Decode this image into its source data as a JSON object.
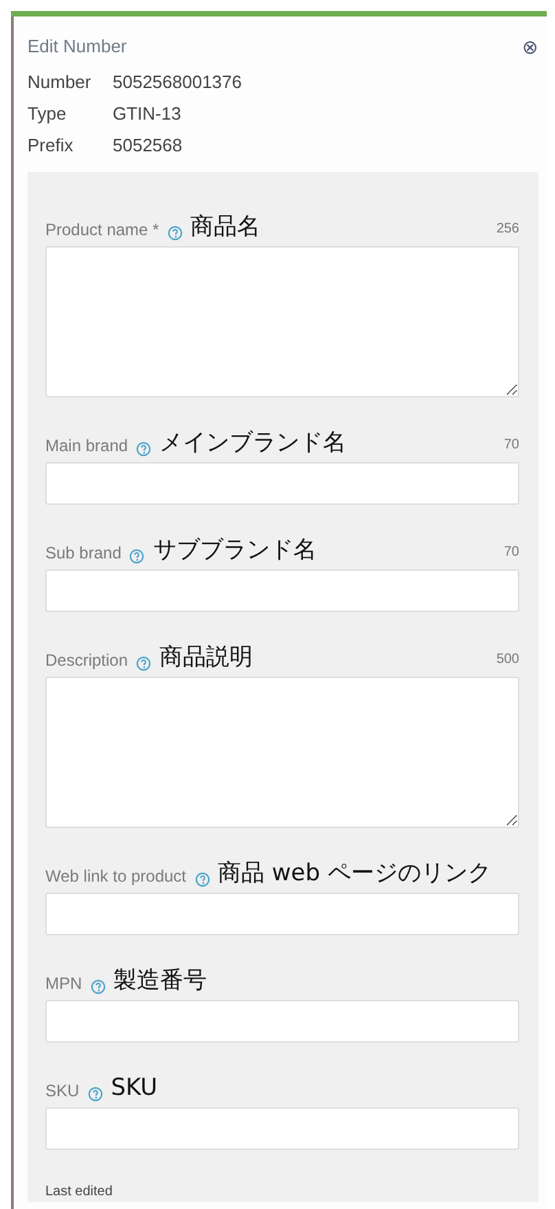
{
  "panel": {
    "title": "Edit Number",
    "close_icon": "⊗"
  },
  "details": [
    {
      "label": "Number",
      "value": "5052568001376"
    },
    {
      "label": "Type",
      "value": "GTIN-13"
    },
    {
      "label": "Prefix",
      "value": "5052568"
    }
  ],
  "fields": [
    {
      "kind": "textarea",
      "label": "Product name *",
      "annotation": "商品名",
      "counter": "256"
    },
    {
      "kind": "input",
      "label": "Main brand",
      "annotation": "メインブランド名",
      "counter": "70"
    },
    {
      "kind": "input",
      "label": "Sub brand",
      "annotation": "サブブランド名",
      "counter": "70"
    },
    {
      "kind": "textarea",
      "label": "Description",
      "annotation": "商品説明",
      "counter": "500"
    },
    {
      "kind": "input",
      "label": "Web link to product",
      "annotation": "商品 web ページのリンク"
    },
    {
      "kind": "input",
      "label": "MPN",
      "annotation": "製造番号"
    },
    {
      "kind": "input",
      "label": "SKU",
      "annotation": "SKU"
    }
  ],
  "footer": {
    "label": "Last edited"
  }
}
